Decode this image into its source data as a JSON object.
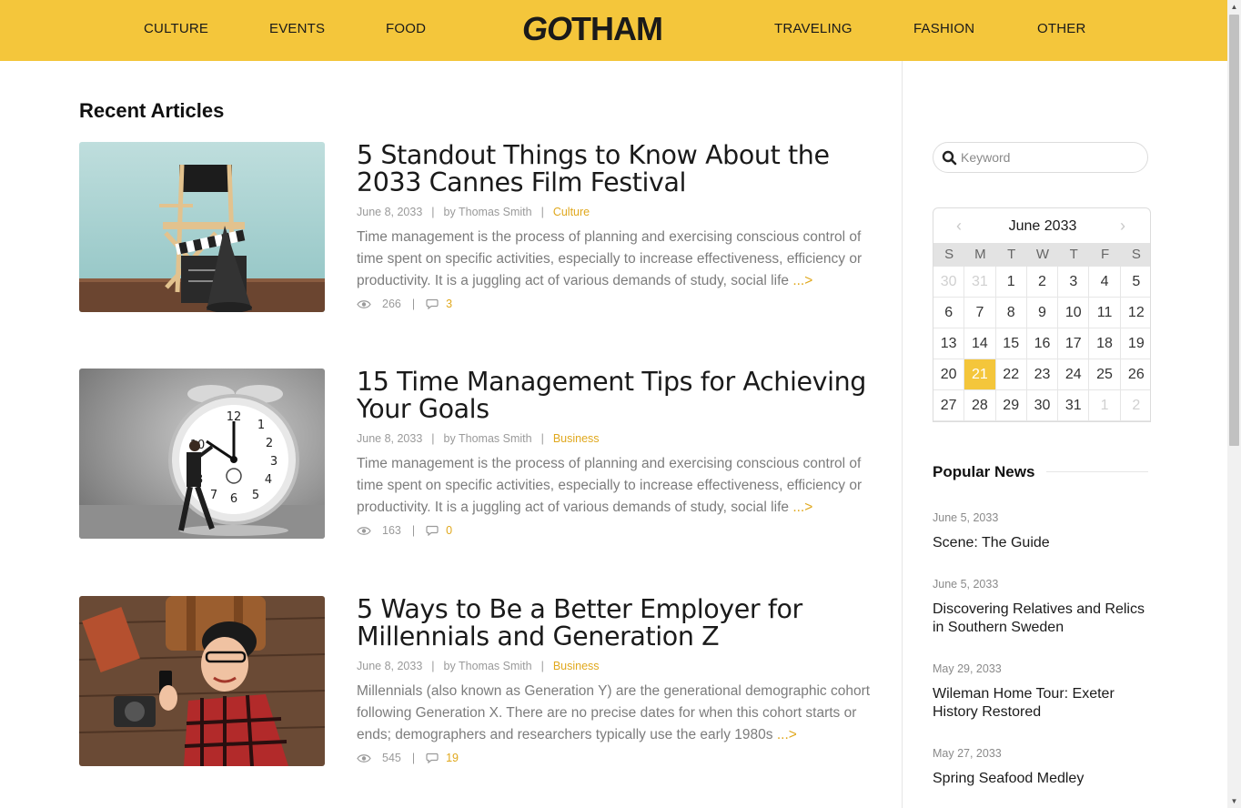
{
  "nav": {
    "left": [
      "CULTURE",
      "EVENTS",
      "FOOD"
    ],
    "logo_prefix": "GO",
    "logo_suffix": "THAM",
    "right": [
      "TRAVELING",
      "FASHION",
      "OTHER"
    ]
  },
  "colors": {
    "accent": "#f4c63b",
    "link": "#e0a81d"
  },
  "main": {
    "section_title": "Recent Articles",
    "articles": [
      {
        "title": "5 Standout Things to Know About the 2033 Cannes Film Festival",
        "date": "June 8, 2033",
        "author": "by Thomas Smith",
        "category": "Culture",
        "excerpt": "Time management is the process of planning and exercising conscious control of time spent on specific activities, especially to increase effectiveness, efficiency or productivity. It is a juggling act of various demands of study, social life",
        "more": "...>",
        "views": "266",
        "comments": "3"
      },
      {
        "title": "15 Time Management Tips for Achieving Your Goals",
        "date": "June 8, 2033",
        "author": "by Thomas Smith",
        "category": "Business",
        "excerpt": "Time management is the process of planning and exercising conscious control of time spent on specific activities, especially to increase effectiveness, efficiency or productivity. It is a juggling act of various demands of study, social life",
        "more": "...>",
        "views": "163",
        "comments": "0"
      },
      {
        "title": "5 Ways to Be a Better Employer for Millennials and Generation Z",
        "date": "June 8, 2033",
        "author": "by Thomas Smith",
        "category": "Business",
        "excerpt": "Millennials (also known as Generation Y) are the generational demographic cohort following Generation X. There are no precise dates for when this cohort starts or ends; demographers and researchers typically use the early 1980s",
        "more": "...>",
        "views": "545",
        "comments": "19"
      }
    ],
    "meta_separator": "|"
  },
  "sidebar": {
    "search": {
      "placeholder": "Keyword",
      "value": ""
    },
    "calendar": {
      "title": "June 2033",
      "prev": "‹",
      "next": "›",
      "weekdays": [
        "S",
        "M",
        "T",
        "W",
        "T",
        "F",
        "S"
      ],
      "weeks": [
        [
          "30",
          "31",
          "1",
          "2",
          "3",
          "4",
          "5"
        ],
        [
          "6",
          "7",
          "8",
          "9",
          "10",
          "11",
          "12"
        ],
        [
          "13",
          "14",
          "15",
          "16",
          "17",
          "18",
          "19"
        ],
        [
          "20",
          "21",
          "22",
          "23",
          "24",
          "25",
          "26"
        ],
        [
          "27",
          "28",
          "29",
          "30",
          "31",
          "1",
          "2"
        ]
      ],
      "today": "21"
    },
    "popular": {
      "title": "Popular News",
      "items": [
        {
          "date": "June 5, 2033",
          "title": "Scene: The Guide"
        },
        {
          "date": "June 5, 2033",
          "title": "Discovering Relatives and Relics in Southern Sweden"
        },
        {
          "date": "May 29, 2033",
          "title": "Wileman Home Tour: Exeter History Restored"
        },
        {
          "date": "May 27, 2033",
          "title": "Spring Seafood Medley"
        }
      ]
    }
  }
}
